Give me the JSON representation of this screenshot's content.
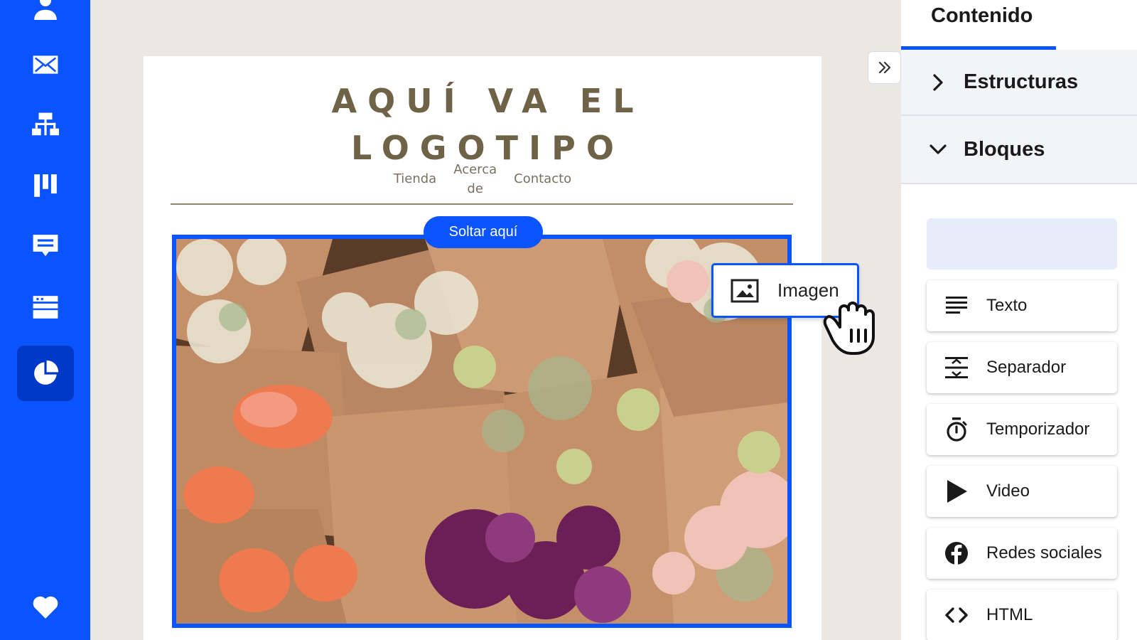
{
  "sidebar": {
    "items": [
      {
        "icon": "user-icon",
        "active": false
      },
      {
        "icon": "mail-icon",
        "active": false
      },
      {
        "icon": "automation-icon",
        "active": false
      },
      {
        "icon": "pipeline-icon",
        "active": false
      },
      {
        "icon": "messages-icon",
        "active": false
      },
      {
        "icon": "website-icon",
        "active": false
      },
      {
        "icon": "reports-icon",
        "active": true
      }
    ],
    "bottom_icon": "heart-icon"
  },
  "email": {
    "logo_line1": "AQUÍ VA EL",
    "logo_line2": "LOGOTIPO",
    "nav": {
      "tienda": "Tienda",
      "acerca_line1": "Acerca",
      "acerca_line2": "de",
      "contacto": "Contacto"
    },
    "drop_label": "Soltar aquí",
    "image_alt_icon": "flowers-photo"
  },
  "drag_chip": {
    "label": "Imagen",
    "icon": "image-icon"
  },
  "panel": {
    "tab": "Contenido",
    "sections": {
      "estructuras": "Estructuras",
      "bloques": "Bloques"
    },
    "blocks": [
      {
        "label": "Texto",
        "icon": "text-icon"
      },
      {
        "label": "Separador",
        "icon": "divider-icon"
      },
      {
        "label": "Temporizador",
        "icon": "timer-icon"
      },
      {
        "label": "Video",
        "icon": "play-icon"
      },
      {
        "label": "Redes sociales",
        "icon": "facebook-icon"
      },
      {
        "label": "HTML",
        "icon": "code-icon"
      }
    ]
  },
  "colors": {
    "brand": "#0a54ff",
    "brand_dark": "#0039c7",
    "canvas_bg": "#ebe8e4",
    "logo": "#6e6347"
  }
}
